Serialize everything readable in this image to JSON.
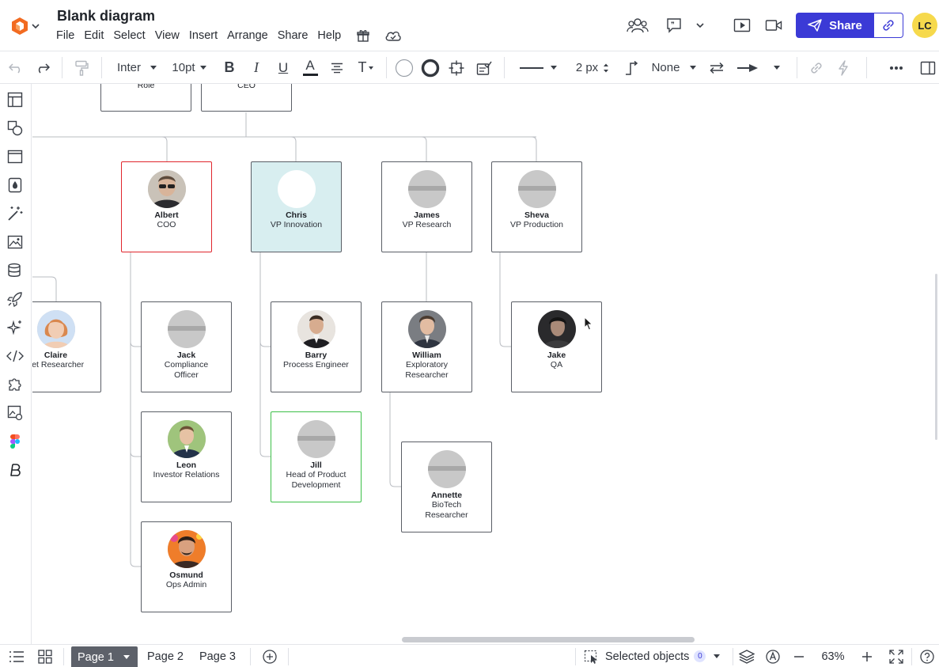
{
  "header": {
    "title": "Blank diagram",
    "menu": [
      "File",
      "Edit",
      "Select",
      "View",
      "Insert",
      "Arrange",
      "Share",
      "Help"
    ],
    "share_label": "Share",
    "user_initials": "LC"
  },
  "toolbar": {
    "font": "Inter",
    "font_size": "10pt",
    "bold": "B",
    "italic": "I",
    "underline": "U",
    "font_color": "A",
    "text_options": "T",
    "line_width": "2 px",
    "arrow_start": "None"
  },
  "canvas": {
    "top_cards": [
      {
        "name": "Role"
      },
      {
        "name": "CEO"
      }
    ],
    "cards": [
      {
        "id": "albert",
        "name": "Albert",
        "role": "COO",
        "photo": "photo-albert"
      },
      {
        "id": "chris",
        "name": "Chris",
        "role": "VP Innovation",
        "photo": "blank"
      },
      {
        "id": "james",
        "name": "James",
        "role": "VP Research",
        "photo": "placeholder"
      },
      {
        "id": "sheva",
        "name": "Sheva",
        "role": "VP Production",
        "photo": "placeholder"
      },
      {
        "id": "claire",
        "name": "Claire",
        "role": "Market Researcher",
        "photo": "photo-claire"
      },
      {
        "id": "jack",
        "name": "Jack",
        "role": "Compliance Officer",
        "photo": "placeholder"
      },
      {
        "id": "barry",
        "name": "Barry",
        "role": "Process Engineer",
        "photo": "photo-barry"
      },
      {
        "id": "william",
        "name": "William",
        "role": "Exploratory Researcher",
        "photo": "photo-william"
      },
      {
        "id": "jake",
        "name": "Jake",
        "role": "QA",
        "photo": "photo-jake"
      },
      {
        "id": "leon",
        "name": "Leon",
        "role": "Investor Relations",
        "photo": "photo-leon"
      },
      {
        "id": "jill",
        "name": "Jill",
        "role": "Head of Product Development",
        "photo": "placeholder"
      },
      {
        "id": "annette",
        "name": "Annette",
        "role": "BioTech Researcher",
        "photo": "placeholder"
      },
      {
        "id": "osmund",
        "name": "Osmund",
        "role": "Ops Admin",
        "photo": "photo-osmund"
      }
    ]
  },
  "bottombar": {
    "pages": [
      "Page 1",
      "Page 2",
      "Page 3"
    ],
    "selected_objects_label": "Selected objects",
    "selected_count": "0",
    "zoom": "63%"
  },
  "colors": {
    "accent": "#3b3ad6",
    "selection_red": "#e0262c",
    "selection_green": "#3cbf48",
    "tinted_card": "#d8eef0",
    "avatar_yellow": "#f6d94c",
    "logo_orange": "#f26b21"
  }
}
